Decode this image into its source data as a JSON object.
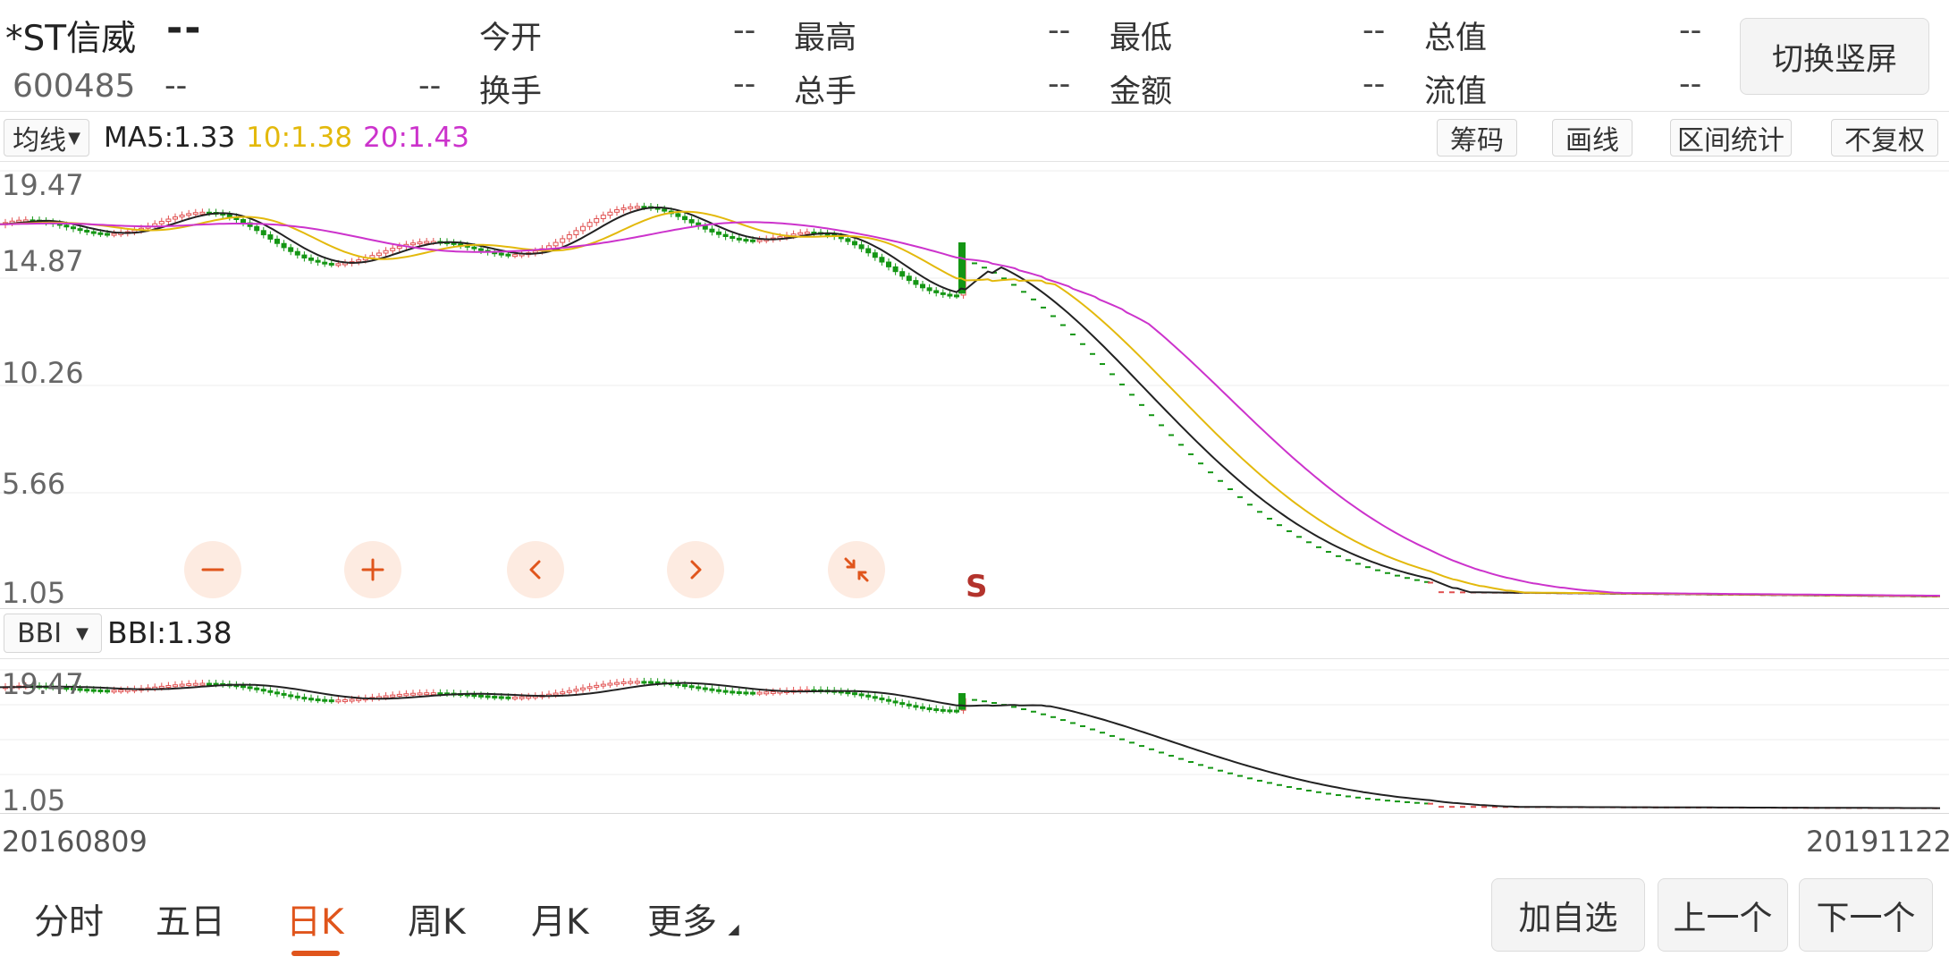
{
  "header": {
    "stock_name": "*ST信威",
    "price_dash": "--",
    "stock_code": "600485",
    "change_dash": "--",
    "change_pct_dash": "--",
    "fields": [
      {
        "label": "今开",
        "value": "--"
      },
      {
        "label": "最高",
        "value": "--"
      },
      {
        "label": "最低",
        "value": "--"
      },
      {
        "label": "总值",
        "value": "--"
      },
      {
        "label": "换手",
        "value": "--"
      },
      {
        "label": "总手",
        "value": "--"
      },
      {
        "label": "金额",
        "value": "--"
      },
      {
        "label": "流值",
        "value": "--"
      }
    ],
    "switch_button": "切换竖屏"
  },
  "ma_bar": {
    "selector": "均线",
    "ma5": "MA5:1.33",
    "ma10": "10:1.38",
    "ma20": "20:1.43",
    "colors": {
      "ma5": "#222222",
      "ma10": "#e3b90c",
      "ma20": "#cc33cc"
    }
  },
  "tools": [
    "筹码",
    "画线",
    "区间统计",
    "不复权"
  ],
  "main_chart": {
    "y_labels": [
      "19.47",
      "14.87",
      "10.26",
      "5.66",
      "1.05"
    ],
    "signal_marker": "S"
  },
  "sub_chart": {
    "selector": "BBI",
    "value": "BBI:1.38",
    "y_labels": [
      "19.47",
      "1.05"
    ]
  },
  "date_range": {
    "start": "20160809",
    "end": "20191122"
  },
  "controls": [
    "zoom-out",
    "zoom-in",
    "move-left",
    "move-right",
    "collapse"
  ],
  "tabs": [
    {
      "label": "分时",
      "active": false
    },
    {
      "label": "五日",
      "active": false
    },
    {
      "label": "日K",
      "active": true
    },
    {
      "label": "周K",
      "active": false
    },
    {
      "label": "月K",
      "active": false
    },
    {
      "label": "更多",
      "active": false
    }
  ],
  "actions": [
    "加自选",
    "上一个",
    "下一个"
  ],
  "chart_data": {
    "type": "candlestick",
    "y_range": [
      1.05,
      19.47
    ],
    "x_range": [
      "20160809",
      "20191122"
    ],
    "series": [
      {
        "name": "MA5",
        "last": 1.33
      },
      {
        "name": "MA10",
        "last": 1.38
      },
      {
        "name": "MA20",
        "last": 1.43
      },
      {
        "name": "BBI",
        "last": 1.38
      }
    ]
  }
}
